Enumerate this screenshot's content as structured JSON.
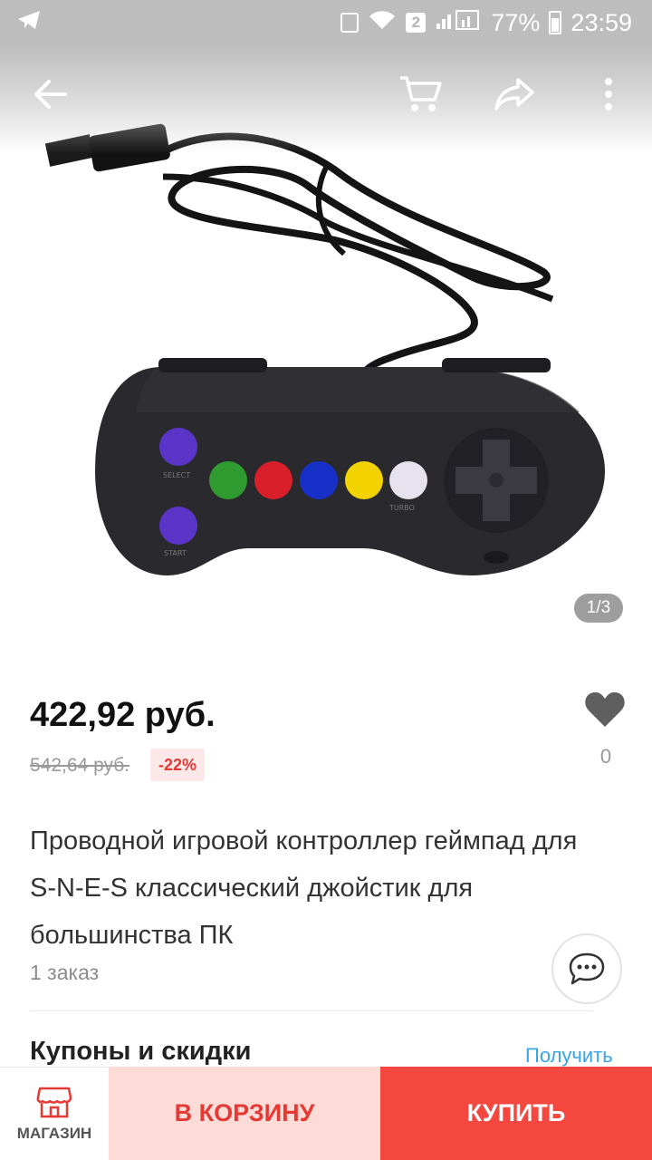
{
  "status_bar": {
    "sim_badge": "2",
    "battery_percent": "77%",
    "time": "23:59"
  },
  "gallery": {
    "pager": "1/3",
    "button_labels": [
      "SELECT",
      "START",
      "TURBO"
    ]
  },
  "product": {
    "price": "422,92 руб.",
    "old_price": "542,64 руб.",
    "discount": "-22%",
    "wishlist_count": "0",
    "title": "Проводной игровой контроллер геймпад для S-N-E-S классический джойстик для большинства ПК",
    "orders": "1 заказ"
  },
  "coupons": {
    "heading": "Купоны и скидки",
    "action": "Получить"
  },
  "bottom_bar": {
    "store_label": "МАГАЗИН",
    "cart_label": "В КОРЗИНУ",
    "buy_label": "КУПИТЬ"
  },
  "colors": {
    "accent_red": "#f4473f",
    "cart_bg": "#fddcd7",
    "link_blue": "#3aa4e8",
    "controller_buttons": [
      "#5b35c8",
      "#2f9a2f",
      "#d81f2a",
      "#1730c8",
      "#f2d200",
      "#e6e3ef"
    ]
  }
}
